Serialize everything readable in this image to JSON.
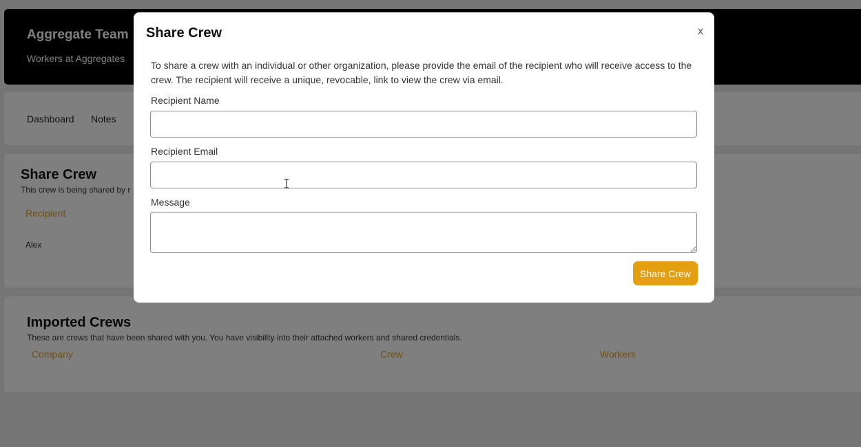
{
  "header": {
    "title": "Aggregate Team",
    "subtitle": "Workers at Aggregates"
  },
  "nav": {
    "items": [
      {
        "label": "Dashboard"
      },
      {
        "label": "Notes"
      }
    ]
  },
  "share_section": {
    "title": "Share Crew",
    "subtitle": "This crew is being shared by r",
    "column_recipient": "Recipient",
    "rows": [
      {
        "recipient": "Alex"
      }
    ]
  },
  "imported_section": {
    "title": "Imported Crews",
    "subtitle": "These are crews that have been shared with you. You have visibility into their attached workers and shared credentials.",
    "columns": [
      "Company",
      "Crew",
      "Workers"
    ]
  },
  "modal": {
    "title": "Share Crew",
    "close_label": "x",
    "description": "To share a crew with an individual or other organization, please provide the email of the recipient who will receive access to the crew. The recipient will receive a unique, revocable, link to view the crew via email.",
    "name_label": "Recipient Name",
    "name_value": "",
    "email_label": "Recipient Email",
    "email_value": "",
    "message_label": "Message",
    "message_value": "",
    "submit_label": "Share Crew"
  },
  "colors": {
    "accent": "#e49f10",
    "column_header": "#e3a11b",
    "header_bg": "#000000"
  },
  "icons": {
    "text_cursor": "text-cursor-icon",
    "resize": "resize-grip-icon"
  }
}
